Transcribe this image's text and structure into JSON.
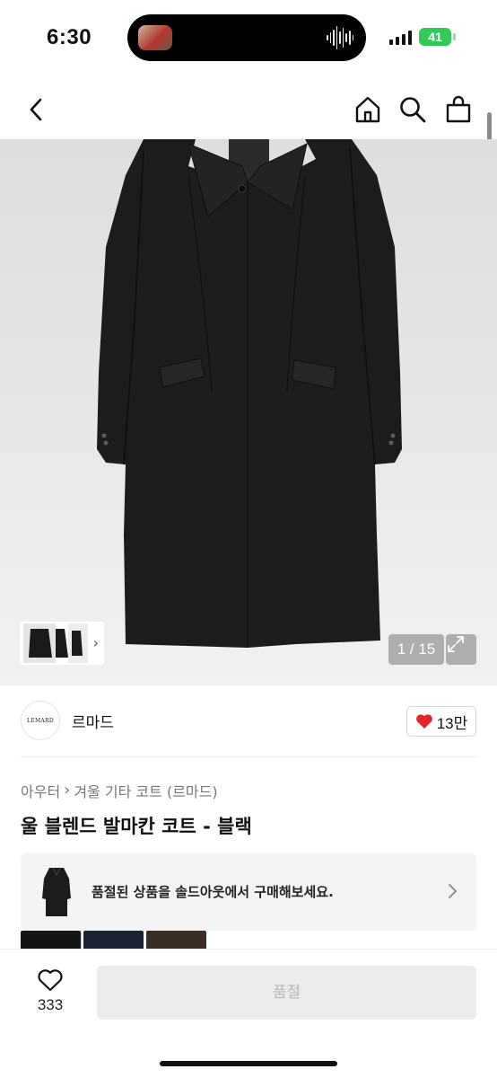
{
  "status_bar": {
    "time": "6:30",
    "battery": "41"
  },
  "hero": {
    "counter": "1 / 15"
  },
  "brand": {
    "logo_text": "LEMARD",
    "name": "르마드",
    "likes": "13만"
  },
  "breadcrumb": {
    "category": "아우터",
    "subcategory": "겨울 기타 코트 (르마드)"
  },
  "product": {
    "title": "울 블렌드 발마칸 코트 - 블랙"
  },
  "soldout_banner": {
    "text": "품절된 상품을 솔드아웃에서 구매해보세요."
  },
  "bottom_bar": {
    "wishlist_count": "333",
    "buy_label": "품절"
  },
  "colors": {
    "accent_heart": "#e0262b",
    "battery": "#34c759"
  }
}
